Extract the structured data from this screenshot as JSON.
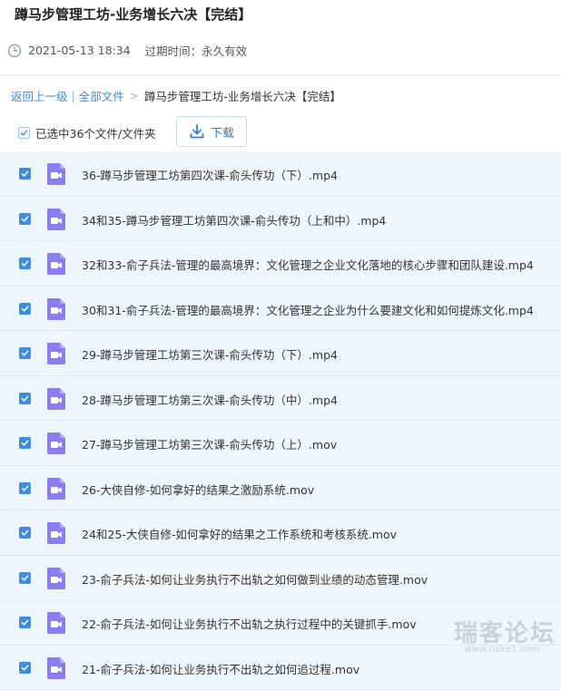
{
  "header": {
    "title": "蹲马步管理工坊-业务增长六决【完结】",
    "date": "2021-05-13 18:34",
    "expiry_label": "过期时间：永久有效"
  },
  "breadcrumb": {
    "back": "返回上一级",
    "separator": "|",
    "all_files": "全部文件",
    "arrow": ">",
    "current": "蹲马步管理工坊-业务增长六决【完结】"
  },
  "toolbar": {
    "selected_label": "已选中36个文件/文件夹",
    "download_label": "下载"
  },
  "files": [
    {
      "name": "36-蹲马步管理工坊第四次课-俞头传功（下）.mp4"
    },
    {
      "name": "34和35-蹲马步管理工坊第四次课-俞头传功（上和中）.mp4"
    },
    {
      "name": "32和33-俞子兵法-管理的最高境界：文化管理之企业文化落地的核心步骤和团队建设.mp4"
    },
    {
      "name": "30和31-俞子兵法-管理的最高境界：文化管理之企业为什么要建文化和如何提炼文化.mp4"
    },
    {
      "name": "29-蹲马步管理工坊第三次课-俞头传功（下）.mp4"
    },
    {
      "name": "28-蹲马步管理工坊第三次课-俞头传功（中）.mp4"
    },
    {
      "name": "27-蹲马步管理工坊第三次课-俞头传功（上）.mov"
    },
    {
      "name": "26-大侠自修-如何拿好的结果之激励系统.mov"
    },
    {
      "name": "24和25-大侠自修-如何拿好的结果之工作系统和考核系统.mov"
    },
    {
      "name": "23-俞子兵法-如何让业务执行不出轨之如何做到业绩的动态管理.mov"
    },
    {
      "name": "22-俞子兵法-如何让业务执行不出轨之执行过程中的关键抓手.mov"
    },
    {
      "name": "21-俞子兵法-如何让业务执行不出轨之如何追过程.mov"
    }
  ],
  "watermark": {
    "main": "瑞客论坛",
    "sub": "www.ruike1.com"
  },
  "colors": {
    "accent": "#3a8ee6",
    "row_bg": "#eef6fd",
    "file_icon": "#8b7cf0"
  }
}
